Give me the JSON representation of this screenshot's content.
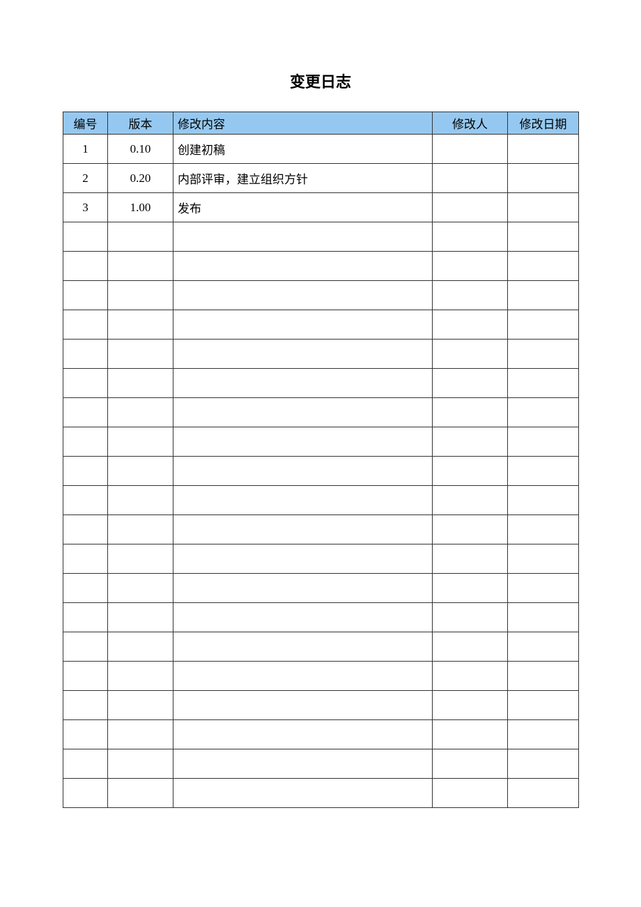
{
  "title": "变更日志",
  "table": {
    "headers": {
      "num": "编号",
      "version": "版本",
      "content": "修改内容",
      "person": "修改人",
      "date": "修改日期"
    },
    "rows": [
      {
        "num": "1",
        "version": "0.10",
        "content": "创建初稿",
        "person": "",
        "date": ""
      },
      {
        "num": "2",
        "version": "0.20",
        "content": "内部评审，建立组织方针",
        "person": "",
        "date": ""
      },
      {
        "num": "3",
        "version": "1.00",
        "content": "发布",
        "person": "",
        "date": ""
      },
      {
        "num": "",
        "version": "",
        "content": "",
        "person": "",
        "date": ""
      },
      {
        "num": "",
        "version": "",
        "content": "",
        "person": "",
        "date": ""
      },
      {
        "num": "",
        "version": "",
        "content": "",
        "person": "",
        "date": ""
      },
      {
        "num": "",
        "version": "",
        "content": "",
        "person": "",
        "date": ""
      },
      {
        "num": "",
        "version": "",
        "content": "",
        "person": "",
        "date": ""
      },
      {
        "num": "",
        "version": "",
        "content": "",
        "person": "",
        "date": ""
      },
      {
        "num": "",
        "version": "",
        "content": "",
        "person": "",
        "date": ""
      },
      {
        "num": "",
        "version": "",
        "content": "",
        "person": "",
        "date": ""
      },
      {
        "num": "",
        "version": "",
        "content": "",
        "person": "",
        "date": ""
      },
      {
        "num": "",
        "version": "",
        "content": "",
        "person": "",
        "date": ""
      },
      {
        "num": "",
        "version": "",
        "content": "",
        "person": "",
        "date": ""
      },
      {
        "num": "",
        "version": "",
        "content": "",
        "person": "",
        "date": ""
      },
      {
        "num": "",
        "version": "",
        "content": "",
        "person": "",
        "date": ""
      },
      {
        "num": "",
        "version": "",
        "content": "",
        "person": "",
        "date": ""
      },
      {
        "num": "",
        "version": "",
        "content": "",
        "person": "",
        "date": ""
      },
      {
        "num": "",
        "version": "",
        "content": "",
        "person": "",
        "date": ""
      },
      {
        "num": "",
        "version": "",
        "content": "",
        "person": "",
        "date": ""
      },
      {
        "num": "",
        "version": "",
        "content": "",
        "person": "",
        "date": ""
      },
      {
        "num": "",
        "version": "",
        "content": "",
        "person": "",
        "date": ""
      },
      {
        "num": "",
        "version": "",
        "content": "",
        "person": "",
        "date": ""
      }
    ]
  }
}
